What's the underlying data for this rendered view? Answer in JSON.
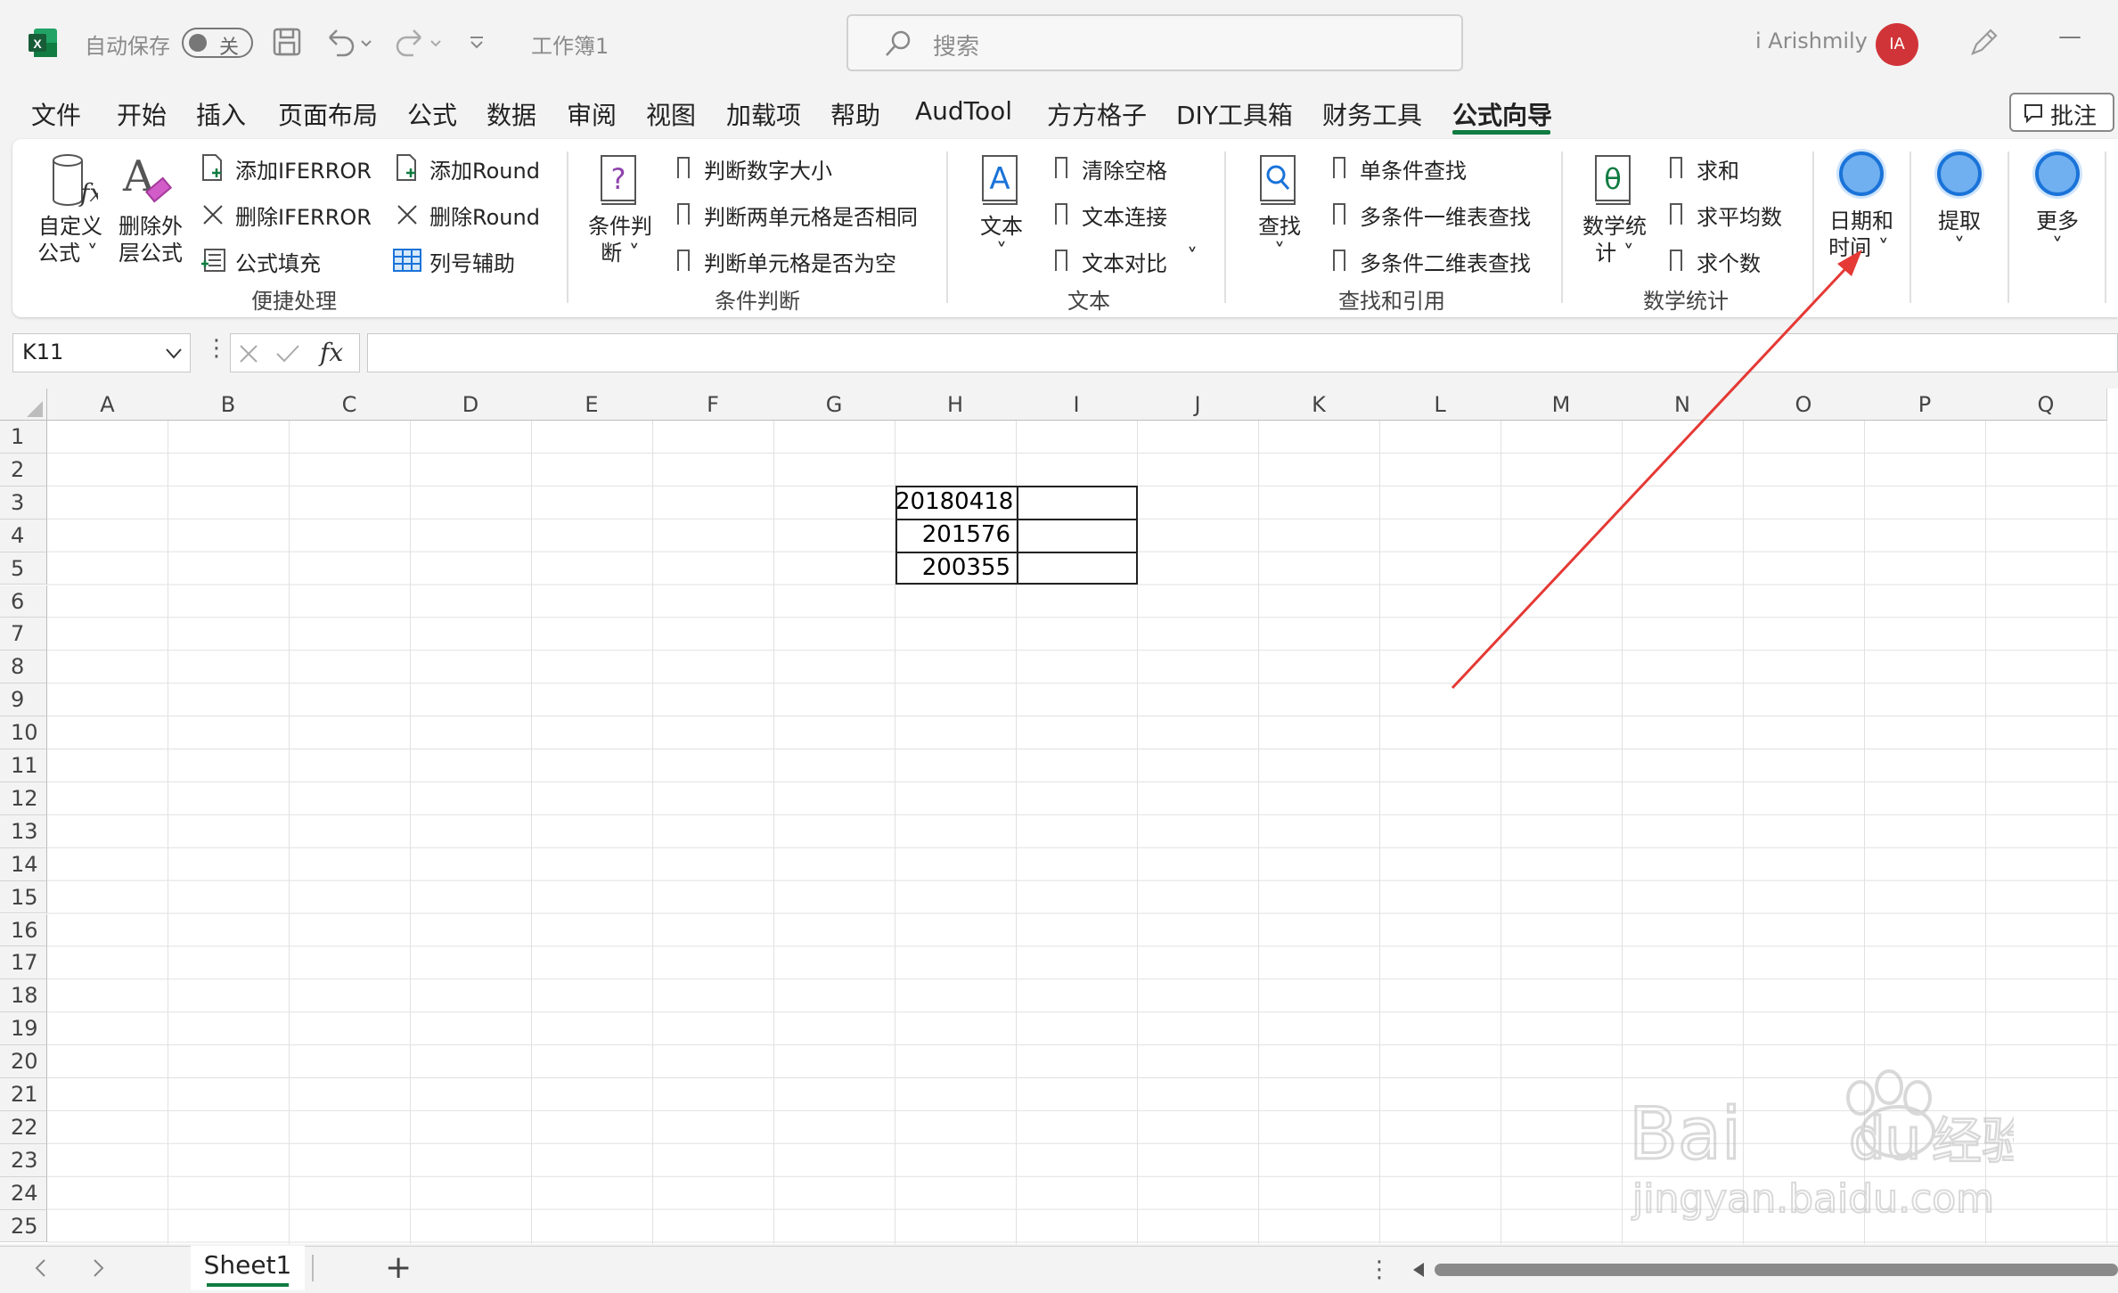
{
  "titlebar": {
    "autosave_label": "自动保存",
    "autosave_state": "关",
    "doc_name": "工作簿1",
    "search_placeholder": "搜索",
    "user_name": "i Arishmily",
    "user_initials": "IA",
    "minimize_glyph": "—"
  },
  "menu": {
    "tabs": [
      "文件",
      "开始",
      "插入",
      "页面布局",
      "公式",
      "数据",
      "审阅",
      "视图",
      "加载项",
      "帮助",
      "AudTool",
      "方方格子",
      "DIY工具箱",
      "财务工具",
      "公式向导"
    ],
    "active_tab": "公式向导",
    "comment_button": "批注"
  },
  "ribbon": {
    "group_quick": {
      "label": "便捷处理",
      "custom_formula": [
        "自定义",
        "公式"
      ],
      "delete_outer": [
        "删除外",
        "层公式"
      ],
      "add_iferror": "添加IFERROR",
      "del_iferror": "删除IFERROR",
      "fill_formula": "公式填充",
      "add_round": "添加Round",
      "del_round": "删除Round",
      "col_helper": "列号辅助"
    },
    "group_condition": {
      "label": "条件判断",
      "big": [
        "条件判",
        "断"
      ],
      "items": [
        "判断数字大小",
        "判断两单元格是否相同",
        "判断单元格是否为空"
      ]
    },
    "group_text": {
      "label": "文本",
      "big": "文本",
      "items": [
        "清除空格",
        "文本连接",
        "文本对比"
      ]
    },
    "group_lookup": {
      "label": "查找和引用",
      "big": "查找",
      "items": [
        "单条件查找",
        "多条件一维表查找",
        "多条件二维表查找"
      ]
    },
    "group_math": {
      "label": "数学统计",
      "big": [
        "数学统",
        "计"
      ],
      "items": [
        "求和",
        "求平均数",
        "求个数"
      ]
    },
    "datetime": [
      "日期和",
      "时间"
    ],
    "extract": "提取",
    "more": "更多"
  },
  "formula_bar": {
    "name_box": "K11",
    "fx_label": "fx",
    "content": ""
  },
  "grid": {
    "columns": [
      "A",
      "B",
      "C",
      "D",
      "E",
      "F",
      "G",
      "H",
      "I",
      "J",
      "K",
      "L",
      "M",
      "N",
      "O",
      "P",
      "Q"
    ],
    "rows": [
      "1",
      "2",
      "3",
      "4",
      "5",
      "6",
      "7",
      "8",
      "9",
      "10",
      "11",
      "12",
      "13",
      "14",
      "15",
      "16",
      "17",
      "18",
      "19",
      "20",
      "21",
      "22",
      "23",
      "24",
      "25"
    ],
    "cells": {
      "H3": "20180418",
      "H4": "201576",
      "H5": "200355"
    }
  },
  "sheets": {
    "active": "Sheet1",
    "add": "+"
  },
  "watermark": {
    "brand": "Baidu经验",
    "url": "jingyan.baidu.com"
  },
  "colors": {
    "excel_green": "#107c41",
    "arrow_red": "#e53935",
    "avatar_red": "#d13438",
    "accent_blue": "#1a73d8"
  }
}
